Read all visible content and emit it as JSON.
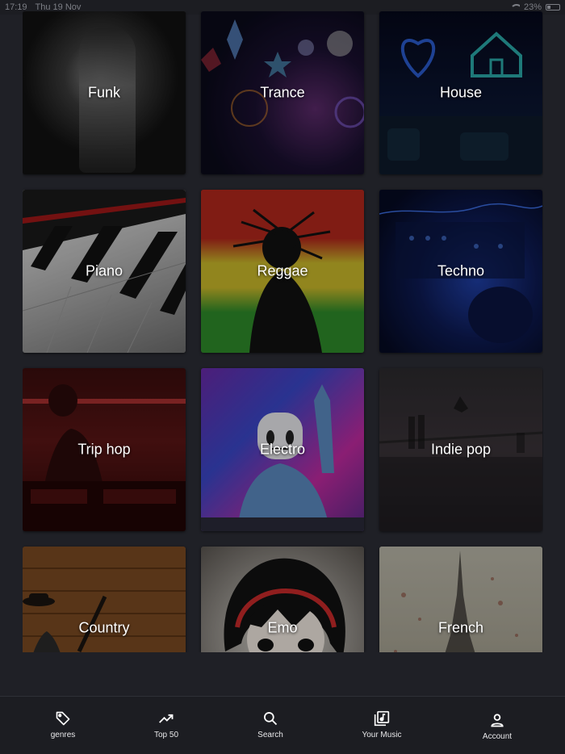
{
  "status_bar": {
    "time": "17:19",
    "date": "Thu 19 Nov",
    "battery": "23%",
    "battery_level": 0.23
  },
  "genres": [
    {
      "label": "Funk"
    },
    {
      "label": "Trance"
    },
    {
      "label": "House"
    },
    {
      "label": "Piano"
    },
    {
      "label": "Reggae"
    },
    {
      "label": "Techno"
    },
    {
      "label": "Trip hop"
    },
    {
      "label": "Electro"
    },
    {
      "label": "Indie pop"
    },
    {
      "label": "Country"
    },
    {
      "label": "Emo"
    },
    {
      "label": "French"
    }
  ],
  "tabs": [
    {
      "label": "genres",
      "icon": "tag-icon"
    },
    {
      "label": "Top 50",
      "icon": "trending-up-icon"
    },
    {
      "label": "Search",
      "icon": "search-icon"
    },
    {
      "label": "Your Music",
      "icon": "music-library-icon"
    },
    {
      "label": "Account",
      "icon": "account-icon"
    }
  ],
  "colors": {
    "background": "#1f2026",
    "tabbar": "#1c1d22",
    "text": "#ffffff"
  }
}
